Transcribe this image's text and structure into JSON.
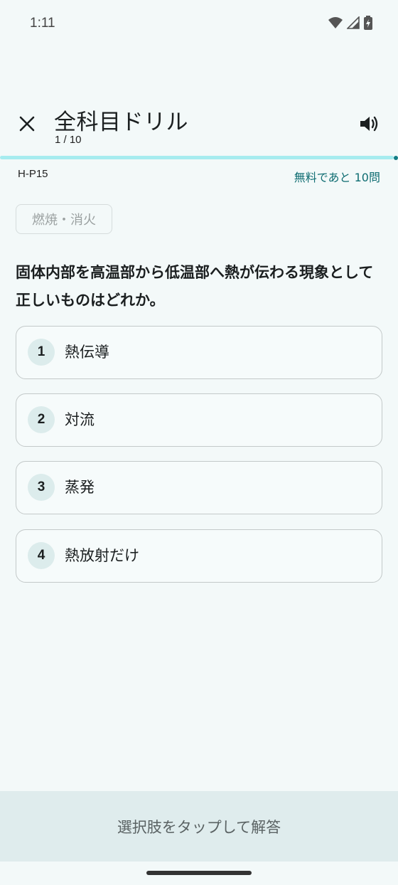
{
  "status_bar": {
    "time": "1:11",
    "icons": [
      "wifi-icon",
      "signal-icon",
      "battery-charging-icon"
    ]
  },
  "header": {
    "title": "全科目ドリル",
    "counter": "1 / 10",
    "close_icon": "close-icon",
    "sound_icon": "volume-icon"
  },
  "progress": {
    "current": 1,
    "total": 10,
    "fill_color": "#a6ecef",
    "dot_color": "#127c84"
  },
  "meta": {
    "code": "H-P15",
    "remaining": "無料であと 10問"
  },
  "category": "燃焼・消火",
  "question": "固体内部を高温部から低温部へ熱が伝わる現象として正しいものはどれか。",
  "options": [
    {
      "num": "1",
      "text": "熱伝導"
    },
    {
      "num": "2",
      "text": "対流"
    },
    {
      "num": "3",
      "text": "蒸発"
    },
    {
      "num": "4",
      "text": "熱放射だけ"
    }
  ],
  "footer": {
    "hint": "選択肢をタップして解答"
  },
  "colors": {
    "background": "#f3f9f9",
    "accent": "#0f6d72",
    "footer_bg": "#dfeced"
  }
}
